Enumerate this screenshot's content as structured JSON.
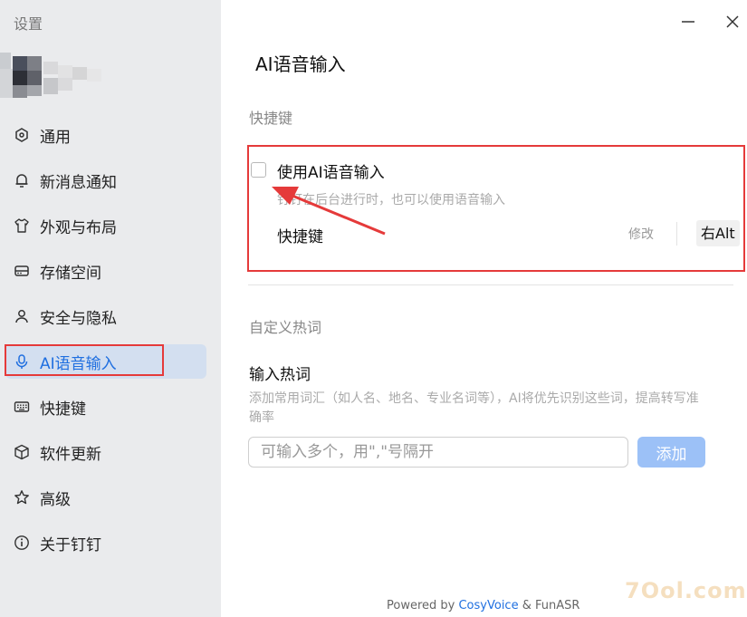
{
  "sidebar": {
    "title": "设置",
    "items": [
      {
        "label": "通用",
        "icon": "general-icon"
      },
      {
        "label": "新消息通知",
        "icon": "bell-icon"
      },
      {
        "label": "外观与布局",
        "icon": "shirt-icon"
      },
      {
        "label": "存储空间",
        "icon": "storage-icon"
      },
      {
        "label": "安全与隐私",
        "icon": "user-icon"
      },
      {
        "label": "AI语音输入",
        "icon": "microphone-icon",
        "active": true
      },
      {
        "label": "快捷键",
        "icon": "keyboard-icon"
      },
      {
        "label": "软件更新",
        "icon": "package-icon"
      },
      {
        "label": "高级",
        "icon": "star-icon"
      },
      {
        "label": "关于钉钉",
        "icon": "info-icon"
      }
    ]
  },
  "window": {
    "minimize_icon": "minimize-icon",
    "close_icon": "close-icon"
  },
  "main": {
    "title": "AI语音输入",
    "shortcut_section": {
      "label": "快捷键",
      "checkbox_label": "使用AI语音输入",
      "checkbox_checked": false,
      "checkbox_desc": "钉钉在后台进行时，也可以使用语音输入",
      "shortcut_label": "快捷键",
      "modify_label": "修改",
      "key": "右Alt"
    },
    "hotword_section": {
      "label": "自定义热词",
      "field_title": "输入热词",
      "desc": "添加常用词汇（如人名、地名、专业名词等），AI将优先识别这些词，提高转写准确率",
      "input_placeholder": "可输入多个，用\",\"号隔开",
      "input_value": "",
      "add_button": "添加"
    },
    "footer": {
      "prefix": "Powered by ",
      "brand": "CosyVoice",
      "suffix": " & FunASR"
    }
  },
  "watermark": "7Ool.com",
  "colors": {
    "accent": "#1f6fe0",
    "annotation_red": "#e53a3a",
    "sidebar_bg": "#eaebed",
    "active_bg": "#d3dff0",
    "add_button_bg": "#9cc1f7"
  }
}
